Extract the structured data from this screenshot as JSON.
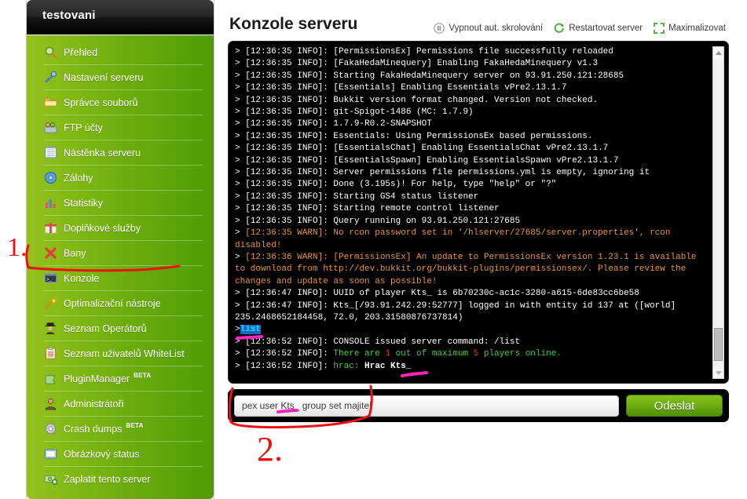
{
  "sidebar": {
    "title": "testovani",
    "items": [
      {
        "label": "Přehled",
        "icon": "magnifier-icon",
        "badge": ""
      },
      {
        "label": "Nastavení serveru",
        "icon": "wrench-icon",
        "badge": ""
      },
      {
        "label": "Správce souborů",
        "icon": "folder-icon",
        "badge": ""
      },
      {
        "label": "FTP účty",
        "icon": "ftp-users-icon",
        "badge": ""
      },
      {
        "label": "Nástěnka serveru",
        "icon": "board-icon",
        "badge": ""
      },
      {
        "label": "Zálohy",
        "icon": "disc-icon",
        "badge": ""
      },
      {
        "label": "Statistiky",
        "icon": "bar-chart-icon",
        "badge": ""
      },
      {
        "label": "Doplňkové služby",
        "icon": "gift-icon",
        "badge": ""
      },
      {
        "label": "Bany",
        "icon": "red-x-icon",
        "badge": ""
      },
      {
        "label": "Konzole",
        "icon": "console-icon",
        "badge": ""
      },
      {
        "label": "Optimalizační nástroje",
        "icon": "magic-wand-icon",
        "badge": ""
      },
      {
        "label": "Seznam Operátorů",
        "icon": "operator-icon",
        "badge": ""
      },
      {
        "label": "Seznam uživatelů WhiteList",
        "icon": "clipboard-icon",
        "badge": ""
      },
      {
        "label": "PluginManager",
        "icon": "puzzle-icon",
        "badge": "BETA"
      },
      {
        "label": "Administrátoři",
        "icon": "admin-icon",
        "badge": ""
      },
      {
        "label": "Crash dumps",
        "icon": "gear-icon",
        "badge": "BETA"
      },
      {
        "label": "Obrázkový status",
        "icon": "picture-icon",
        "badge": ""
      },
      {
        "label": "Zaplatit tento server",
        "icon": "money-icon",
        "badge": ""
      }
    ]
  },
  "main": {
    "page_title": "Konzole serveru",
    "toolbar": {
      "pause_scroll": "Vypnout aut. skrolování",
      "restart_server": "Restartovat server",
      "maximize": "Maximalizovat"
    },
    "console": {
      "lines": [
        {
          "prefix": "> ",
          "ts": "[12:36:35 INFO]: ",
          "level": "INFO",
          "text": "[PermissionsEx] Permissions file successfully reloaded"
        },
        {
          "prefix": "> ",
          "ts": "[12:36:35 INFO]: ",
          "level": "INFO",
          "text": "[FakaHedaMinequery] Enabling FakaHedaMinequery v1.3"
        },
        {
          "prefix": "> ",
          "ts": "[12:36:35 INFO]: ",
          "level": "INFO",
          "text": "Starting FakaHedaMinequery server on 93.91.250.121:28685"
        },
        {
          "prefix": "> ",
          "ts": "[12:36:35 INFO]: ",
          "level": "INFO",
          "text": "[Essentials] Enabling Essentials vPre2.13.1.7"
        },
        {
          "prefix": "> ",
          "ts": "[12:36:35 INFO]: ",
          "level": "INFO",
          "text": "Bukkit version format changed. Version not checked."
        },
        {
          "prefix": "> ",
          "ts": "[12:36:35 INFO]: ",
          "level": "INFO",
          "text": "git-Spigot-1486 (MC: 1.7.9)"
        },
        {
          "prefix": "> ",
          "ts": "[12:36:35 INFO]: ",
          "level": "INFO",
          "text": "1.7.9-R0.2-SNAPSHOT"
        },
        {
          "prefix": "> ",
          "ts": "[12:36:35 INFO]: ",
          "level": "INFO",
          "text": "Essentials: Using PermissionsEx based permissions."
        },
        {
          "prefix": "> ",
          "ts": "[12:36:35 INFO]: ",
          "level": "INFO",
          "text": "[EssentialsChat] Enabling EssentialsChat vPre2.13.1.7"
        },
        {
          "prefix": "> ",
          "ts": "[12:36:35 INFO]: ",
          "level": "INFO",
          "text": "[EssentialsSpawn] Enabling EssentialsSpawn vPre2.13.1.7"
        },
        {
          "prefix": "> ",
          "ts": "[12:36:35 INFO]: ",
          "level": "INFO",
          "text": "Server permissions file permissions.yml is empty, ignoring it"
        },
        {
          "prefix": "> ",
          "ts": "[12:36:35 INFO]: ",
          "level": "INFO",
          "text": "Done (3.195s)! For help, type \"help\" or \"?\""
        },
        {
          "prefix": "> ",
          "ts": "[12:36:35 INFO]: ",
          "level": "INFO",
          "text": "Starting GS4 status listener"
        },
        {
          "prefix": "> ",
          "ts": "[12:36:35 INFO]: ",
          "level": "INFO",
          "text": "Starting remote control listener"
        },
        {
          "prefix": "> ",
          "ts": "[12:36:35 INFO]: ",
          "level": "INFO",
          "text": "Query running on 93.91.250.121:27685"
        },
        {
          "prefix": "> ",
          "ts": "[12:36:35 WARN]: ",
          "level": "WARN",
          "text": "No rcon password set in '/hlserver/27685/server.properties', rcon disabled!"
        },
        {
          "prefix": "> ",
          "ts": "[12:36:36 WARN]: ",
          "level": "WARN",
          "text": "[PermissionsEx] An update to PermissionsEx version 1.23.1 is available to download from http://dev.bukkit.org/bukkit-plugins/permissionsex/. Please review the changes and update as soon as possible!"
        },
        {
          "prefix": "> ",
          "ts": "[12:36:47 INFO]: ",
          "level": "INFO",
          "text": "UUID of player Kts_ is 6b70230c-ac1c-3280-a615-6de83cc6be58"
        },
        {
          "prefix": "> ",
          "ts": "[12:36:47 INFO]: ",
          "level": "INFO",
          "text": "Kts_[/93.91.242.29:52777] logged in with entity id 137 at ([world] 235.2468652184458, 72.0, 203.31580876737814)"
        },
        {
          "prefix": ">",
          "ts": "",
          "level": "SELECTED",
          "text": "list"
        },
        {
          "prefix": "> ",
          "ts": "[12:36:52 INFO]: ",
          "level": "INFO",
          "text": "CONSOLE issued server command: /list"
        },
        {
          "prefix": "> ",
          "ts": "[12:36:52 INFO]: ",
          "level": "PLAYERCOUNT",
          "text": "There are 1 out of maximum 5 players online.",
          "count_online": "1",
          "count_max": "5"
        },
        {
          "prefix": "> ",
          "ts": "[12:36:52 INFO]: ",
          "level": "PLAYERLIST",
          "text": "hrac: Hrac Kts_",
          "group": "hrac: ",
          "players": "Hrac Kts_"
        }
      ]
    },
    "input": {
      "value": "pex user Kts_ group set majitel",
      "placeholder": "",
      "send_label": "Odeslat"
    }
  },
  "annotations": {
    "marker_one": "1.",
    "marker_two": "2."
  },
  "colors": {
    "accent_green": "#6fae10",
    "sidebar_light": "#95c11f",
    "sidebar_dark": "#4e9d07",
    "console_bg": "#000000",
    "warn": "#e8962c",
    "ok_green": "#3fd13f",
    "count_red": "#e33b3b",
    "annotation_red": "#ee1111",
    "annotation_pink": "#ff22bb",
    "selection_blue": "#1567c8"
  }
}
